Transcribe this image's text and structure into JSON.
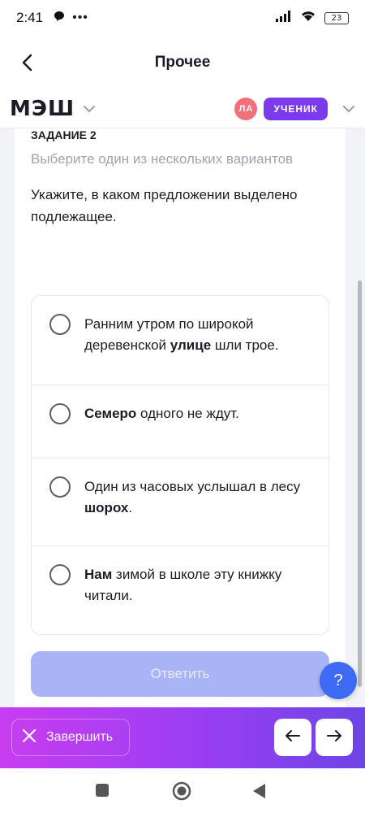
{
  "status_bar": {
    "time": "2:41",
    "battery": "23"
  },
  "header": {
    "title": "Прочее"
  },
  "app": {
    "logo": "МЭШ",
    "avatar_initials": "ЛА",
    "role": "УЧЕНИК"
  },
  "task": {
    "label": "ЗАДАНИЕ 2",
    "hint": "Выберите один из нескольких вариантов",
    "question": "Укажите, в каком предложении выделено подлежащее.",
    "options": [
      {
        "pre": "Ранним утром по широкой деревенской ",
        "bold": "улице",
        "post": " шли трое."
      },
      {
        "pre": "",
        "bold": "Семеро",
        "post": " одного не ждут."
      },
      {
        "pre": "Один из часовых услышал в лесу ",
        "bold": "шорох",
        "post": "."
      },
      {
        "pre": "",
        "bold": "Нам",
        "post": " зимой в школе эту книжку читали."
      }
    ],
    "submit_label": "Ответить"
  },
  "help_label": "?",
  "bottom_bar": {
    "finish_label": "Завершить"
  },
  "colors": {
    "accent": "#7c3aed",
    "submit_disabled": "#a9b4f7",
    "help": "#3d6bf5",
    "avatar": "#f2707b"
  }
}
